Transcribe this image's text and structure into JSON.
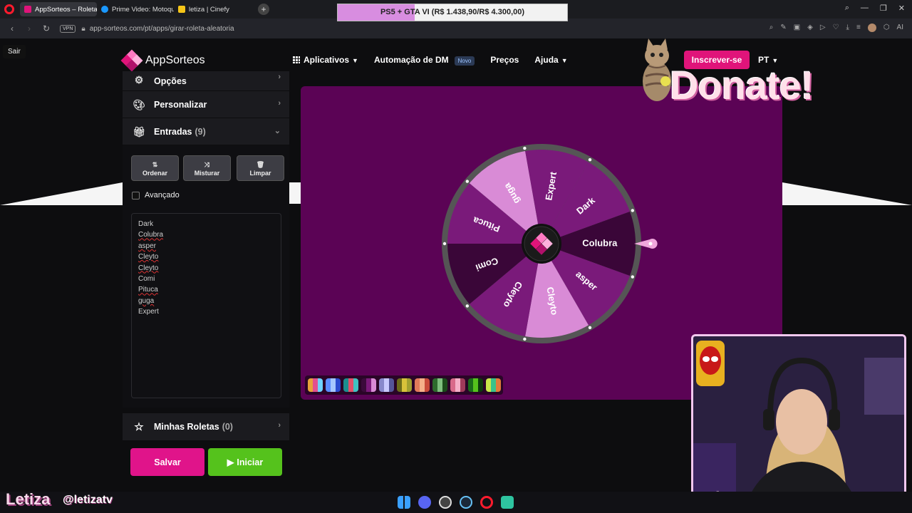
{
  "browser": {
    "tabs": [
      {
        "label": "AppSorteos – Roleta Aleatória",
        "color": "#e0147a",
        "active": true
      },
      {
        "label": "Prime Video: Motoqueiro",
        "color": "#1a98ff",
        "active": false
      },
      {
        "label": "letiza | Cinefy",
        "color": "#f5c518",
        "active": false
      }
    ],
    "new_tab": "+",
    "address": "app-sorteos.com/pt/apps/girar-roleta-aleatoria",
    "vpn": "VPN",
    "tools_ai": "AI",
    "exit_label": "Sair"
  },
  "promo": {
    "text": "PS5 + GTA VI (R$ 1.438,90/R$ 4.300,00)",
    "progress": 0.335,
    "fill_color": "#d88de0"
  },
  "site": {
    "brand": "AppSorteos",
    "nav": {
      "apps": "Aplicativos",
      "dm": "Automação de DM",
      "dm_badge": "Novo",
      "prices": "Preços",
      "help": "Ajuda"
    },
    "login_partial": "r",
    "signup": "Inscrever-se",
    "lang": "PT",
    "accent": "#e0147a"
  },
  "sidebar": {
    "options": "Opções",
    "personalize": "Personalizar",
    "entries": "Entradas",
    "entries_count": "(9)",
    "buttons": {
      "sort": "Ordenar",
      "shuffle": "Misturar",
      "clear": "Limpar"
    },
    "advanced": "Avançado",
    "entry_list": [
      {
        "text": "Dark",
        "spell": false
      },
      {
        "text": "Colubra",
        "spell": true
      },
      {
        "text": "asper",
        "spell": true
      },
      {
        "text": "Cleyto",
        "spell": true
      },
      {
        "text": "Cleyto",
        "spell": true
      },
      {
        "text": "Comi",
        "spell": false
      },
      {
        "text": "Pituca",
        "spell": true
      },
      {
        "text": "guga",
        "spell": true
      },
      {
        "text": "Expert",
        "spell": false
      }
    ],
    "my_wheels": "Minhas Roletas",
    "my_wheels_count": "(0)",
    "save": "Salvar",
    "start": "Iniciar",
    "save_color": "#e0148a",
    "start_color": "#55c21c"
  },
  "wheel": {
    "bg": "#5b0355",
    "rim": "#555555",
    "segments": [
      {
        "label": "Colubra",
        "color": "#3a0638"
      },
      {
        "label": "asper",
        "color": "#7a1a7a"
      },
      {
        "label": "Cleyto",
        "color": "#d98bd6"
      },
      {
        "label": "Cleyto",
        "color": "#7a1a7a"
      },
      {
        "label": "Comi",
        "color": "#3a0638"
      },
      {
        "label": "Pituca",
        "color": "#7a1a7a"
      },
      {
        "label": "guga",
        "color": "#d98bd6"
      },
      {
        "label": "Expert",
        "color": "#7a1a7a"
      },
      {
        "label": "Dark",
        "color": "#7a1a7a"
      }
    ]
  },
  "palettes": [
    [
      "#e8a23a",
      "#e2508f",
      "#6ed3ff"
    ],
    [
      "#5b8cff",
      "#a5c6ff",
      "#2a4bd0"
    ],
    [
      "#1a8f8f",
      "#e2506a",
      "#3fc2c2"
    ],
    [
      "#3b0a3b",
      "#7a1a7a",
      "#d98bd6"
    ],
    [
      "#8888cc",
      "#c8c8ff",
      "#555599"
    ],
    [
      "#6b6b1a",
      "#d8c23a",
      "#a0a030"
    ],
    [
      "#e27a5a",
      "#f5b08a",
      "#c84a3a"
    ],
    [
      "#2d6b2d",
      "#7fbf7f",
      "#1a4a1a"
    ],
    [
      "#d86a8a",
      "#f5b0c8",
      "#a03a5a"
    ],
    [
      "#1a6b1a",
      "#55c21c",
      "#0d3d0d"
    ],
    [
      "#c8e84a",
      "#3ac28a",
      "#e27a3a"
    ]
  ],
  "overlay": {
    "donate": "Donate!",
    "streamer_name": "Letiza",
    "streamer_handle": "@letizatv"
  }
}
